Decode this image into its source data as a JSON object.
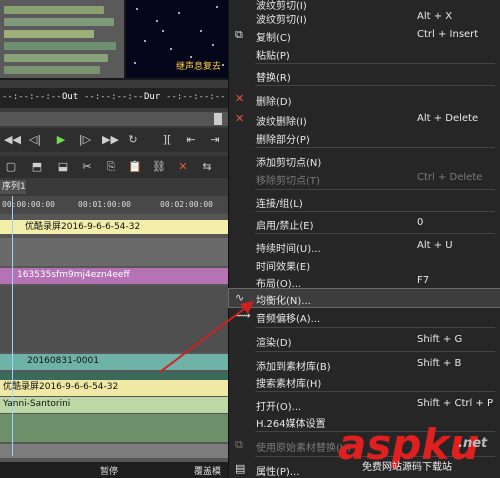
{
  "left": {
    "caption": "继声息复去",
    "timecode": {
      "out_label": "Out",
      "out_value": "--:--:--:--",
      "dur_label": "Dur",
      "dur_value": "--:--:--:--",
      "in_value": "--:--:--:--"
    },
    "sequence_tab": "序列1",
    "ruler": [
      "00:00:00:00",
      "00:01:00:00",
      "00:02:00:00"
    ],
    "clips": {
      "c1": "优酷录屏2016-9-6-6-54-32",
      "c2": "163535sfm9mj4ezn4eeff",
      "c3": "20160831-0001",
      "c4": "优酷录屏2016-9-6-6-54-32",
      "c5": "Yanni-Santorini"
    },
    "bottom": {
      "pause": "暂停",
      "overwrite": "覆盖模"
    }
  },
  "menu": {
    "items": [
      {
        "label": "波纹剪切(I)",
        "shortcut": "",
        "disabled": false
      },
      {
        "label": "波纹剪切(I)",
        "shortcut": "Alt + X",
        "disabled": false
      },
      {
        "label": "复制(C)",
        "shortcut": "Ctrl + Insert",
        "disabled": false
      },
      {
        "label": "粘贴(P)",
        "shortcut": "",
        "disabled": false
      },
      {
        "label": "替换(R)",
        "shortcut": "",
        "disabled": false
      },
      {
        "label": "删除(D)",
        "shortcut": "",
        "disabled": false
      },
      {
        "label": "波纹删除(I)",
        "shortcut": "Alt + Delete",
        "disabled": false
      },
      {
        "label": "删除部分(P)",
        "shortcut": "",
        "disabled": false
      },
      {
        "label": "添加剪切点(N)",
        "shortcut": "",
        "disabled": false
      },
      {
        "label": "移除剪切点(T)",
        "shortcut": "Ctrl + Delete",
        "disabled": true
      },
      {
        "label": "连接/组(L)",
        "shortcut": "",
        "disabled": false
      },
      {
        "label": "启用/禁止(E)",
        "shortcut": "0",
        "disabled": false
      },
      {
        "label": "持续时间(U)...",
        "shortcut": "Alt + U",
        "disabled": false
      },
      {
        "label": "时间效果(E)",
        "shortcut": "",
        "disabled": false
      },
      {
        "label": "布局(O)...",
        "shortcut": "F7",
        "disabled": false
      },
      {
        "label": "均衡化(N)...",
        "shortcut": "",
        "disabled": false,
        "highlighted": true
      },
      {
        "label": "音频偏移(A)...",
        "shortcut": "",
        "disabled": false
      },
      {
        "label": "渲染(D)",
        "shortcut": "Shift + G",
        "disabled": false
      },
      {
        "label": "添加到素材库(B)",
        "shortcut": "Shift + B",
        "disabled": false
      },
      {
        "label": "搜索素材库(H)",
        "shortcut": "",
        "disabled": false
      },
      {
        "label": "打开(O)...",
        "shortcut": "Shift + Ctrl + P",
        "disabled": false
      },
      {
        "label": "H.264媒体设置",
        "shortcut": "",
        "disabled": false
      },
      {
        "label": "使用原始素材替换(U)",
        "shortcut": "",
        "disabled": true
      },
      {
        "label": "属性(P)...",
        "shortcut": "",
        "disabled": false
      }
    ]
  },
  "watermark": {
    "brand": "aspku",
    "net": ".net",
    "sub": "免费网站源码下载站"
  }
}
